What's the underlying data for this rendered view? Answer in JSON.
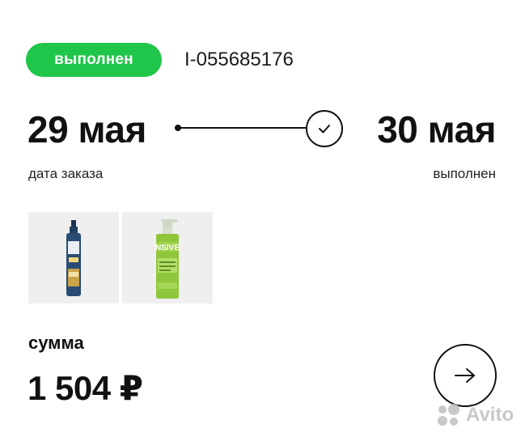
{
  "order": {
    "status": "выполнен",
    "id": "I-055685176",
    "date_from": "29 мая",
    "date_from_label": "дата заказа",
    "date_to": "30 мая",
    "date_to_label": "выполнен",
    "sum_label": "сумма",
    "sum_value": "1 504 ₽"
  },
  "products": [
    {
      "icon": "blue-spray-bottle"
    },
    {
      "icon": "green-pump-bottle",
      "label_text": "NSIVE"
    }
  ],
  "watermark": {
    "text": "Avito"
  },
  "colors": {
    "status_green": "#1fc64a",
    "text": "#111111",
    "thumb_bg": "#efefef"
  }
}
